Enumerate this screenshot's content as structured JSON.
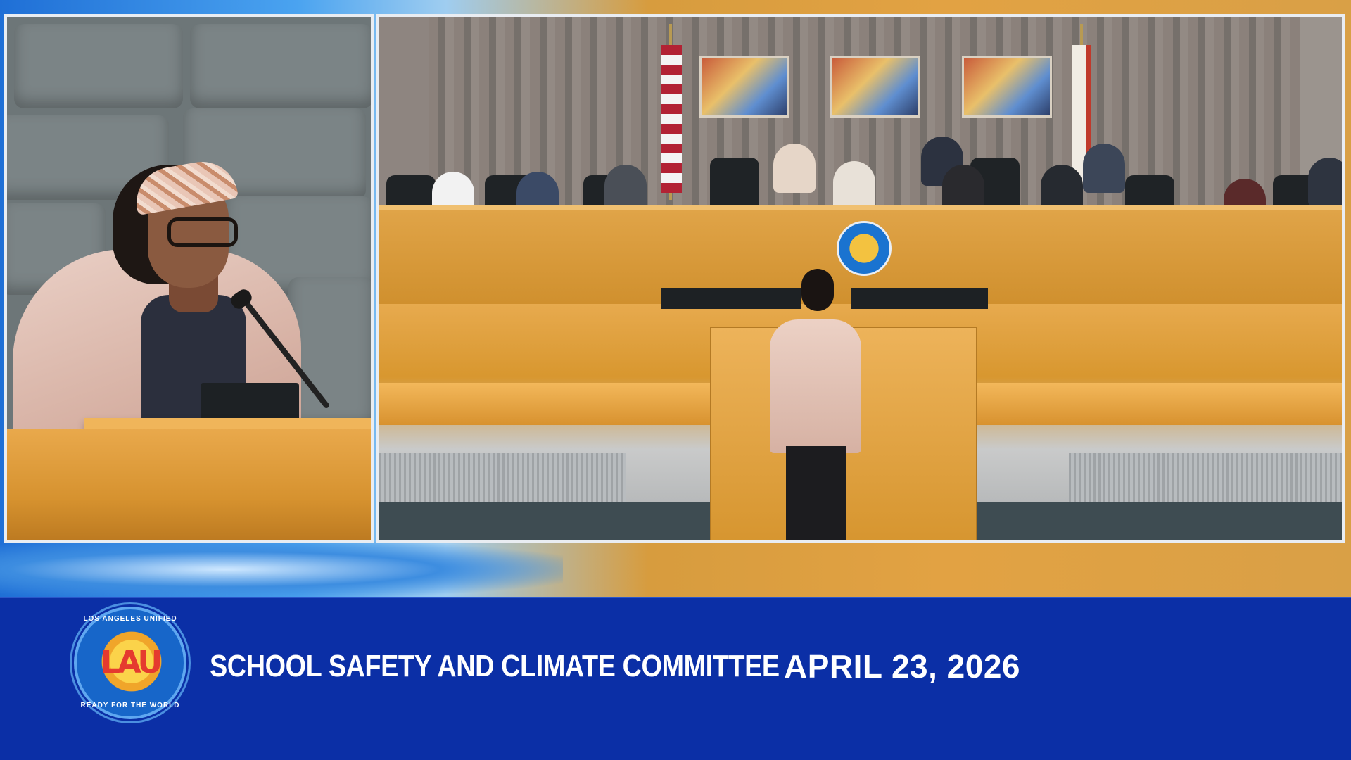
{
  "banner": {
    "title": "SCHOOL SAFETY AND CLIMATE COMMITTEE",
    "date": "APRIL 23, 2026",
    "logo": {
      "top_text": "LOS ANGELES UNIFIED",
      "glyph": "LAU",
      "bottom_text": "READY FOR THE WORLD"
    }
  },
  "colors": {
    "banner_background": "#0b2fa6",
    "banner_text": "#ffffff",
    "pane_border": "#e9edf2",
    "wood": "#d6952f"
  },
  "panes": {
    "left": {
      "name": "speaker-video-feed"
    },
    "right": {
      "name": "board-chamber-video-feed"
    }
  }
}
